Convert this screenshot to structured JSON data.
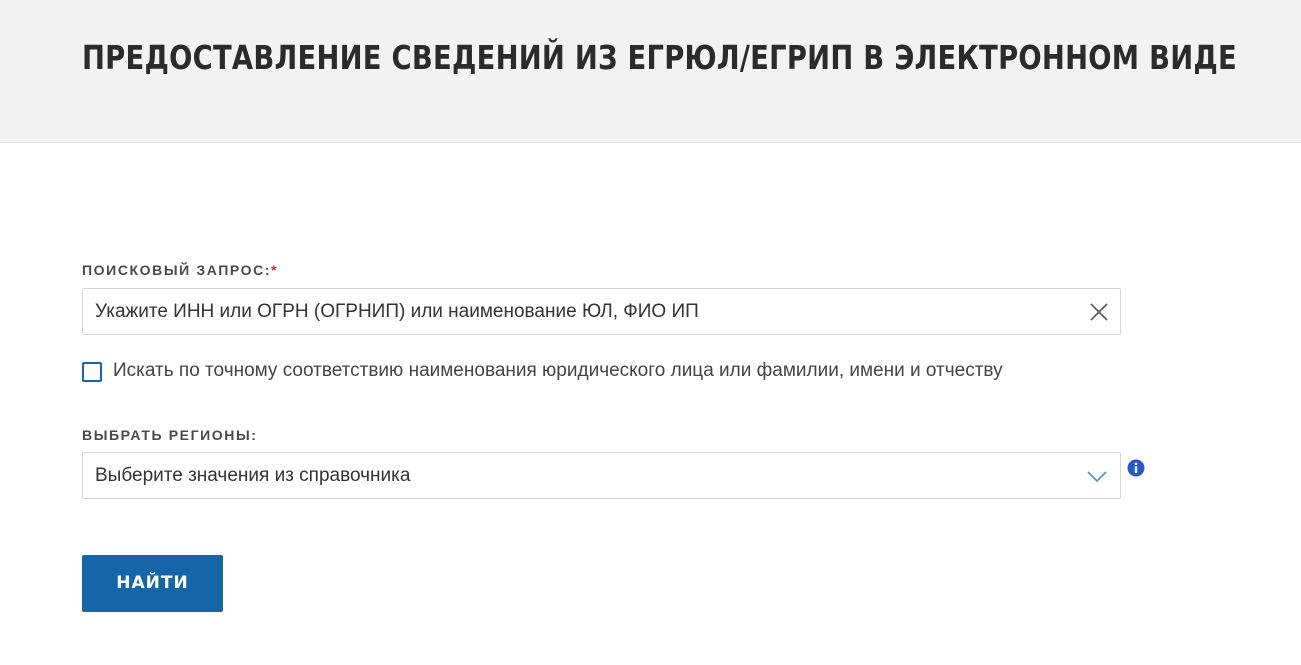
{
  "header": {
    "title": "ПРЕДОСТАВЛЕНИЕ СВЕДЕНИЙ ИЗ ЕГРЮЛ/ЕГРИП В ЭЛЕКТРОННОМ ВИДЕ"
  },
  "search": {
    "label": "ПОИСКОВЫЙ ЗАПРОС:",
    "required_mark": "*",
    "placeholder": "Укажите ИНН или ОГРН (ОГРНИП) или наименование ЮЛ, ФИО ИП",
    "value": "",
    "clear_icon": "close-icon"
  },
  "exact_match": {
    "label": "Искать по точному соответствию наименования юридического лица или фамилии, имени и отчеству",
    "checked": false
  },
  "regions": {
    "label": "ВЫБРАТЬ РЕГИОНЫ:",
    "selected_text": "Выберите значения из справочника",
    "dropdown_icon": "chevron-down-icon",
    "info_icon": "info-icon"
  },
  "actions": {
    "submit_label": "НАЙТИ"
  },
  "colors": {
    "accent": "#1565a9",
    "required": "#d0262b",
    "header_bg": "#f2f2f2",
    "info": "#2a55c7"
  }
}
